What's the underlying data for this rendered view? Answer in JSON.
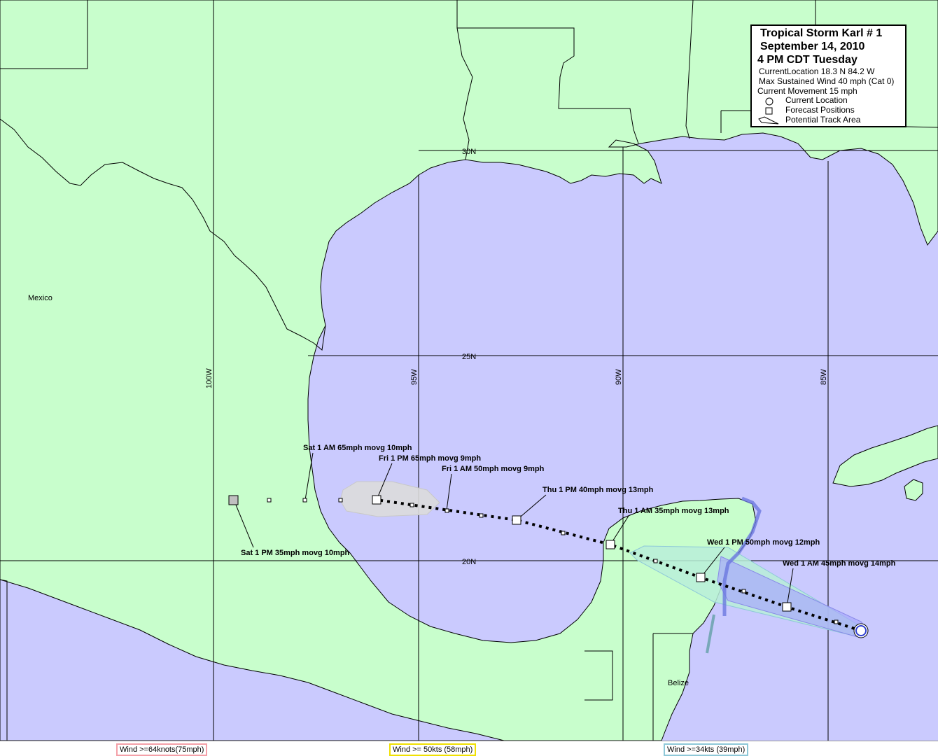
{
  "legend": {
    "title_line1": "Tropical Storm Karl # 1",
    "title_line2": "September 14, 2010",
    "title_line3": "4 PM CDT Tuesday",
    "current_location": "CurrentLocation 18.3 N  84.2 W",
    "max_wind": "Max Sustained Wind 40 mph (Cat 0)",
    "movement": "Current Movement 15 mph",
    "items": [
      {
        "label": "Current Location",
        "icon": "circle-icon"
      },
      {
        "label": "Forecast Positions",
        "icon": "square-icon"
      },
      {
        "label": "Potential Track Area",
        "icon": "cone-icon"
      }
    ]
  },
  "grid_labels": {
    "lat_30": "30N",
    "lat_25": "25N",
    "lat_20": "20N",
    "lon_100": "100W",
    "lon_95": "95W",
    "lon_90": "90W",
    "lon_85": "85W"
  },
  "place_labels": {
    "mexico": "Mexico",
    "belize": "Belize"
  },
  "forecast_labels": {
    "wed_1am": "Wed 1 AM 45mph movg 14mph",
    "wed_1pm": "Wed 1 PM 50mph movg 12mph",
    "thu_1am": "Thu 1 AM 35mph movg 13mph",
    "thu_1pm": "Thu 1 PM 40mph movg 13mph",
    "fri_1am": "Fri 1 AM 50mph movg 9mph",
    "fri_1pm": "Fri 1 PM 65mph movg 9mph",
    "sat_1am": "Sat 1 AM 65mph movg 10mph",
    "sat_1pm": "Sat 1 PM 35mph movg 10mph"
  },
  "wind_keys": {
    "hurricane": "Wind >=64knots(75mph)",
    "strong": "Wind >= 50kts (58mph)",
    "tropical": "Wind >=34kts (39mph)"
  },
  "colors": {
    "land": "#c8fecc",
    "water": "#cacafe",
    "hurricane_border": "#f4a0a8",
    "strong_border": "#f0e000",
    "tropical_border": "#8ec8d8",
    "cone_green": "#b8eed8",
    "cone_blue": "#a8a8fc",
    "cone_gray": "#dcdcdc"
  }
}
